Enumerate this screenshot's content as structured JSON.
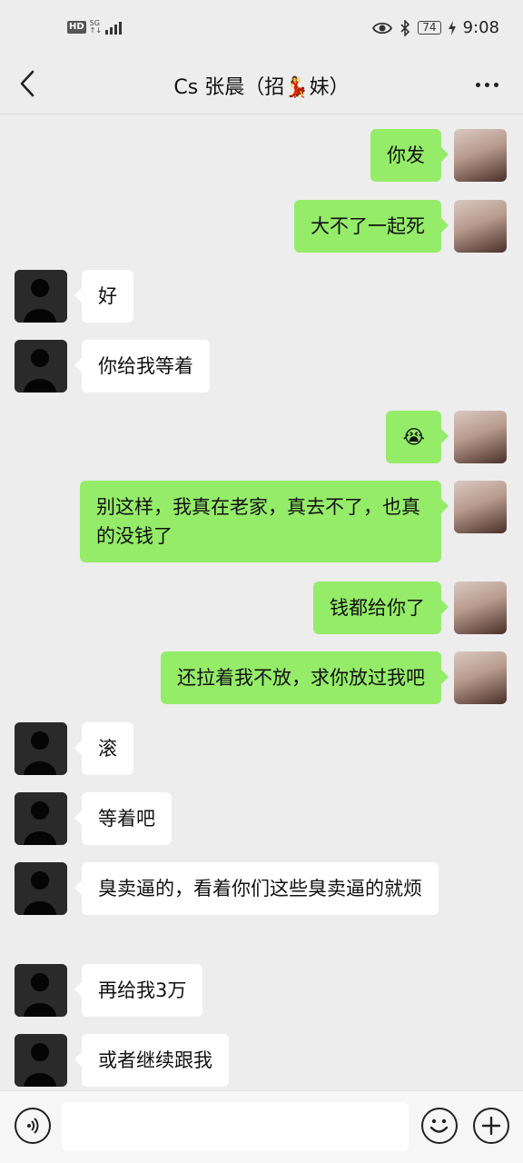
{
  "status_bar": {
    "hd": "HD",
    "network_top": "5G",
    "network_bottom": "↑↓",
    "battery": "74",
    "time": "9:08"
  },
  "header": {
    "title": "Cs 张晨（招💃妹）"
  },
  "messages": [
    {
      "side": "me",
      "text": "你发"
    },
    {
      "side": "me",
      "text": "大不了一起死"
    },
    {
      "side": "other",
      "text": "好"
    },
    {
      "side": "other",
      "text": "你给我等着"
    },
    {
      "side": "me",
      "text": "😭"
    },
    {
      "side": "me",
      "text": "别这样，我真在老家，真去不了，也真的没钱了"
    },
    {
      "side": "me",
      "text": "钱都给你了"
    },
    {
      "side": "me",
      "text": "还拉着我不放，求你放过我吧"
    },
    {
      "side": "other",
      "text": "滚"
    },
    {
      "side": "other",
      "text": "等着吧"
    },
    {
      "side": "other",
      "text": "臭卖逼的，看着你们这些臭卖逼的就烦"
    },
    {
      "side": "other",
      "text": "再给我3万"
    },
    {
      "side": "other",
      "text": "或者继续跟我"
    }
  ],
  "input": {
    "placeholder": ""
  },
  "icons": {
    "back": "back-arrow-icon",
    "more": "more-dots-icon",
    "voice": "voice-icon",
    "emoji": "emoji-icon",
    "plus": "plus-icon"
  },
  "colors": {
    "background": "#ededed",
    "my_bubble": "#95ec69",
    "their_bubble": "#ffffff"
  }
}
